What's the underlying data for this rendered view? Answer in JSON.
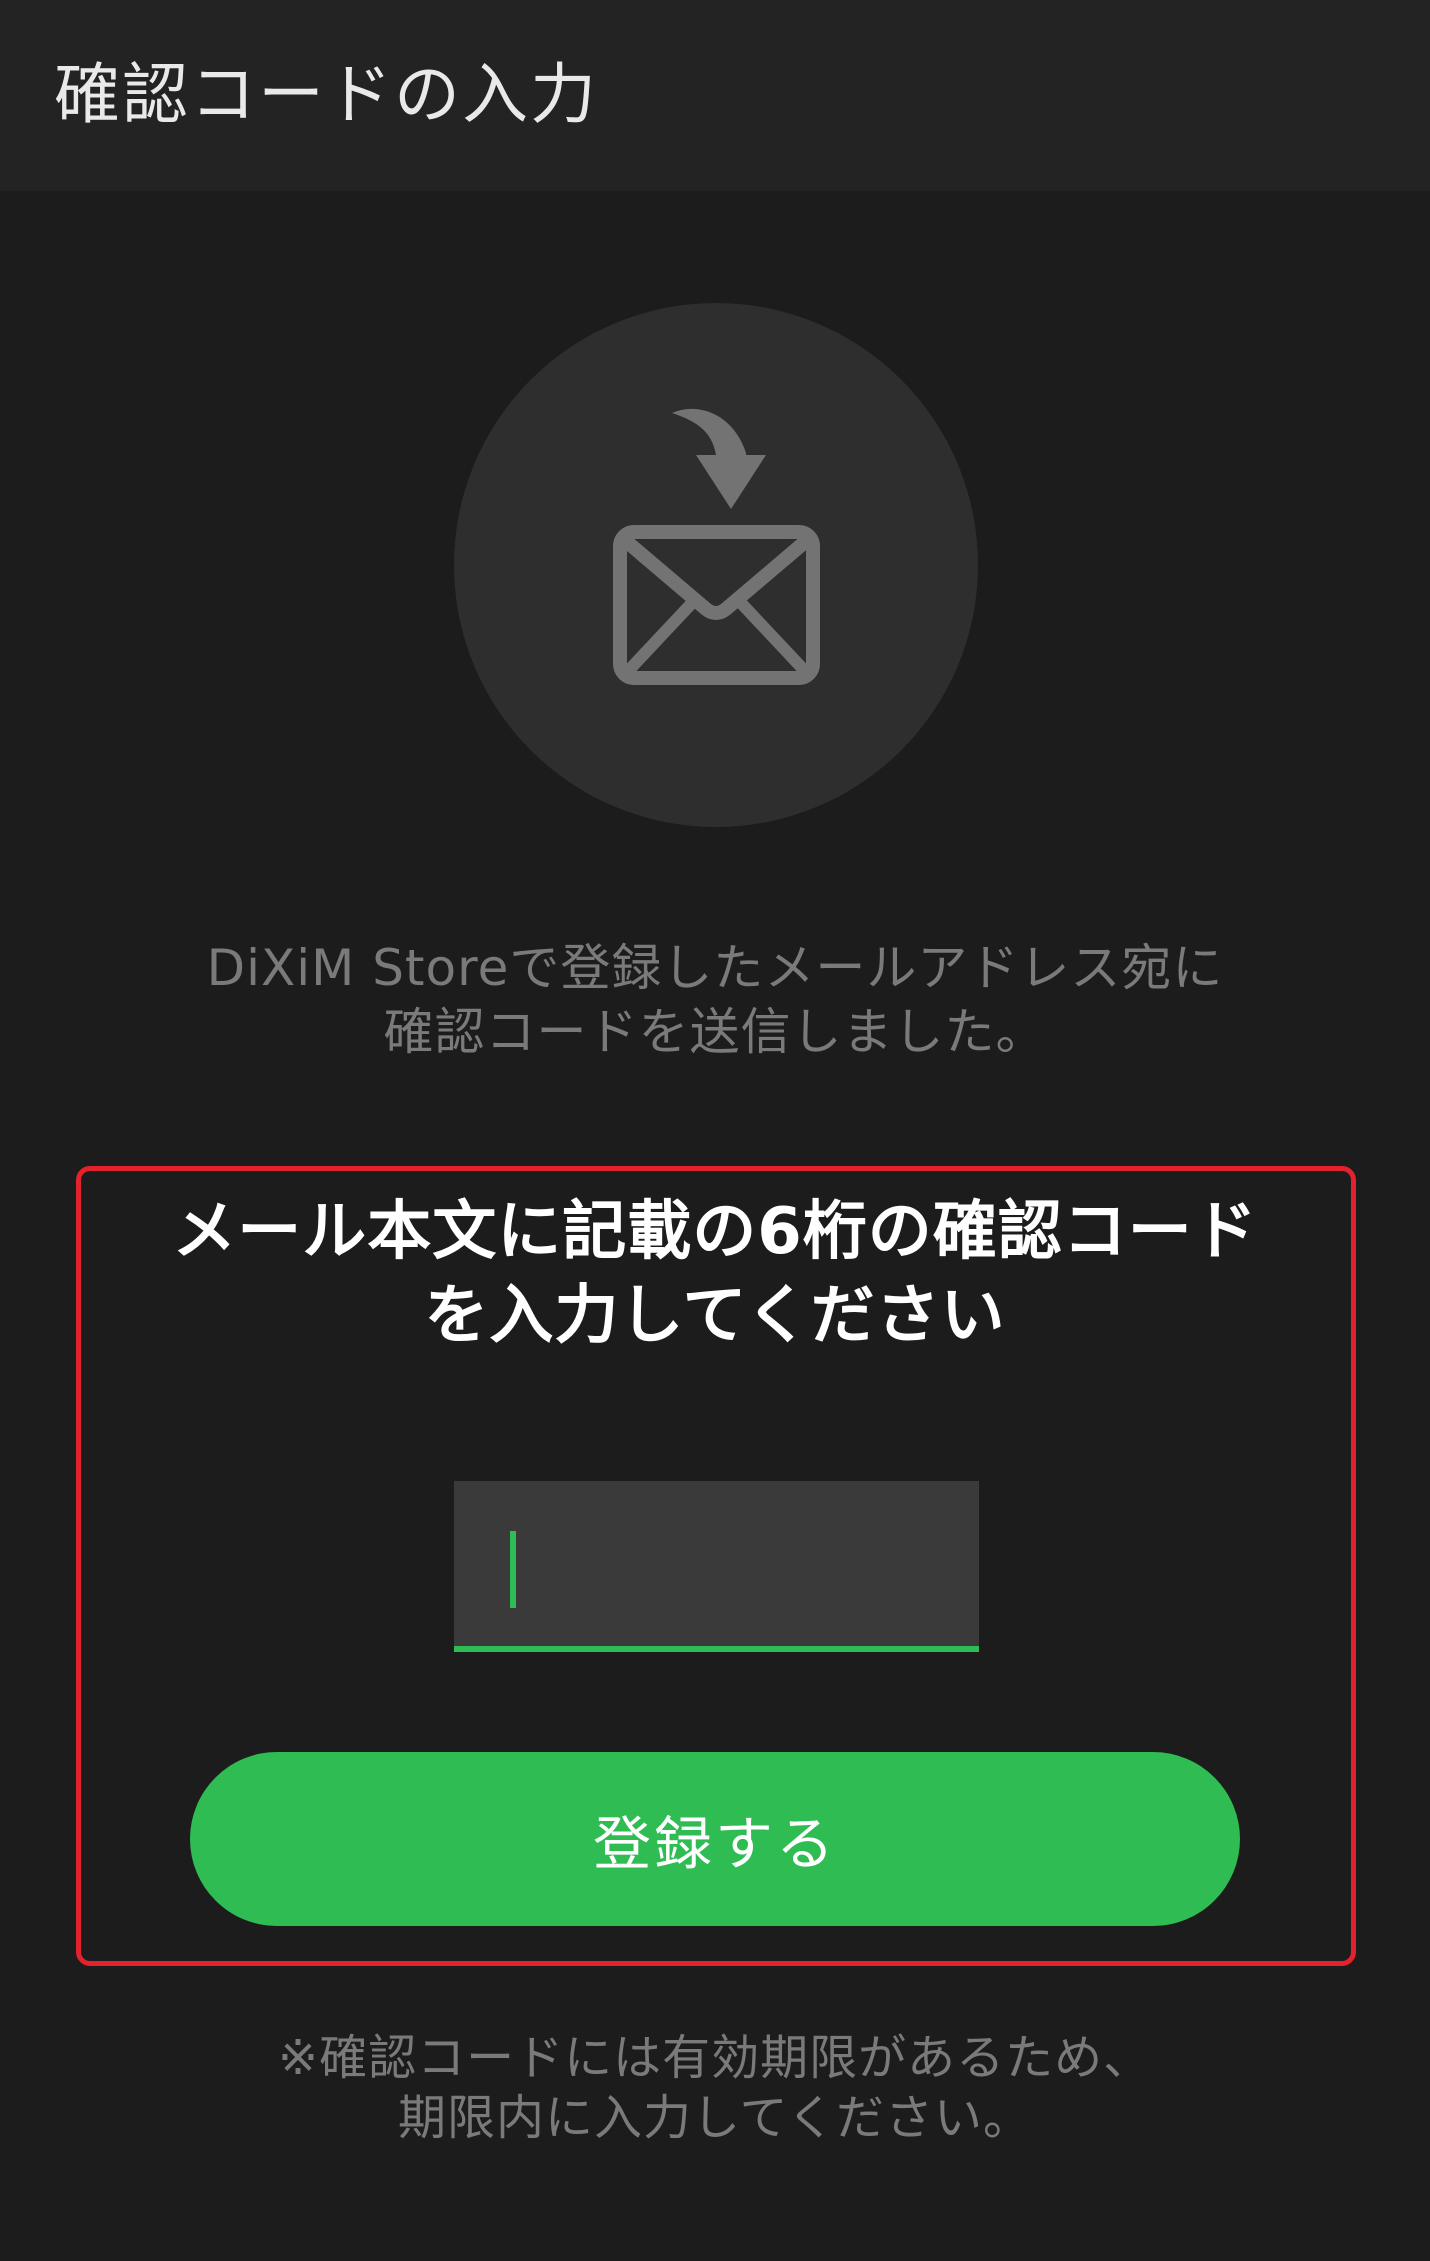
{
  "app_bar": {
    "title": "確認コードの入力"
  },
  "mail_icon": {
    "name": "mail-download-icon"
  },
  "description": {
    "line1": "DiXiM Storeで登録したメールアドレス宛に",
    "line2": "確認コードを送信しました。"
  },
  "instruction": {
    "line1": "メール本文に記載の6桁の確認コード",
    "line2": "を入力してください"
  },
  "code_input": {
    "value": "",
    "placeholder": ""
  },
  "register_button": {
    "label": "登録する"
  },
  "note": {
    "line1": "※確認コードには有効期限があるため、",
    "line2": "期限内に入力してください。"
  },
  "colors": {
    "background": "#1c1c1c",
    "app_bar": "#232323",
    "accent_green": "#2fbd53",
    "highlight_red": "#e3222d",
    "muted_text": "#7a7a7a",
    "icon_gray": "#737373"
  }
}
